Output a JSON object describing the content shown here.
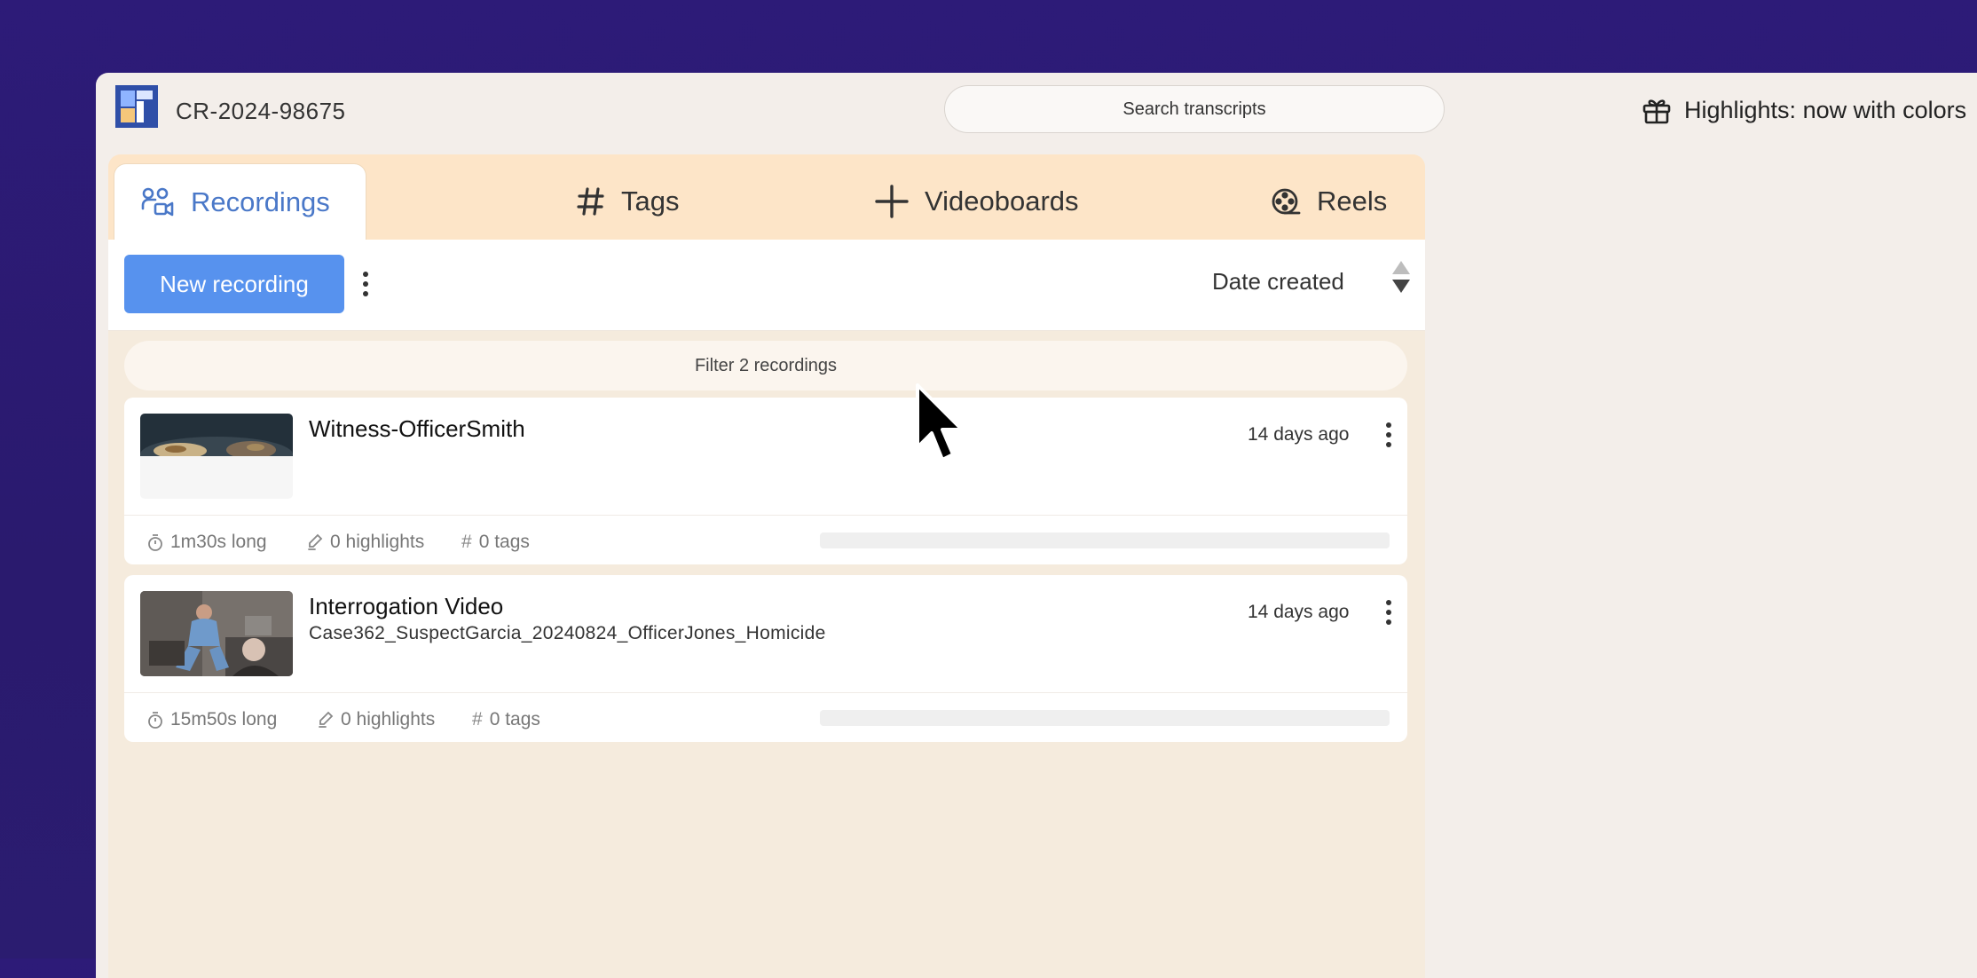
{
  "header": {
    "project_name": "CR-2024-98675",
    "search_placeholder": "Search transcripts",
    "announcement": "Highlights: now with colors"
  },
  "tabs": [
    {
      "label": "Recordings",
      "icon": "users-video-icon",
      "active": true
    },
    {
      "label": "Tags",
      "icon": "hash-icon",
      "active": false
    },
    {
      "label": "Videoboards",
      "icon": "plus-icon",
      "active": false
    },
    {
      "label": "Reels",
      "icon": "film-reel-icon",
      "active": false
    }
  ],
  "toolbar": {
    "new_recording_label": "New recording",
    "sort_label": "Date created"
  },
  "filter_label": "Filter 2 recordings",
  "recordings": [
    {
      "title": "Witness-OfficerSmith",
      "subtitle": "",
      "date": "14 days ago",
      "duration": "1m30s long",
      "highlights": "0 highlights",
      "tags": "0 tags",
      "progress": 0
    },
    {
      "title": "Interrogation Video",
      "subtitle": "Case362_SuspectGarcia_20240824_OfficerJones_Homicide",
      "date": "14 days ago",
      "duration": "15m50s long",
      "highlights": "0 highlights",
      "tags": "0 tags",
      "progress": 0
    }
  ],
  "colors": {
    "background": "#2d1b78",
    "accent": "#5792ee",
    "active_tab_text": "#4a78c8",
    "tab_bar": "#fde5c8",
    "panel": "#f5ebdd"
  }
}
